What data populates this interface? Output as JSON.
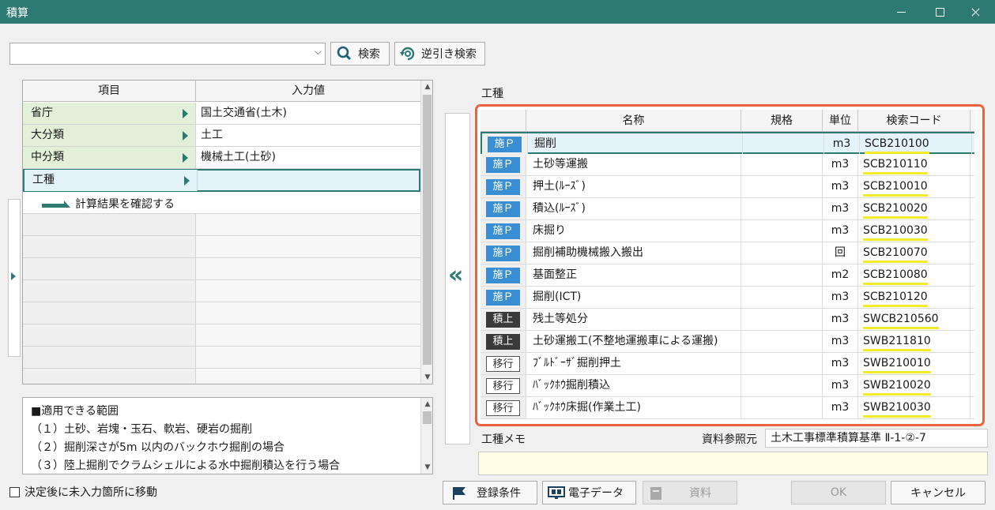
{
  "window": {
    "title": "積算"
  },
  "toolbar": {
    "combo_value": "",
    "search_label": "検索",
    "reverse_search_label": "逆引き検索"
  },
  "left_grid": {
    "headers": [
      "項目",
      "入力値"
    ],
    "rows": [
      {
        "key": "省庁",
        "value": "国土交通省(土木)"
      },
      {
        "key": "大分類",
        "value": "土工"
      },
      {
        "key": "中分類",
        "value": "機械土工(土砂)"
      },
      {
        "key": "工種",
        "value": ""
      }
    ],
    "calc_link": "計算結果を確認する"
  },
  "scope_memo": {
    "lines": [
      "■適用できる範囲",
      "（１）土砂、岩塊・玉石、軟岩、硬岩の掘削",
      "（２）掘削深さが5m 以内のバックホウ掘削の場合",
      "（３）陸上掘削でクラムシェルによる水中掘削積込を行う場合"
    ]
  },
  "options": {
    "move_to_unfilled": "決定後に未入力箇所に移動"
  },
  "right_panel": {
    "section_title": "工種",
    "headers": {
      "name": "名称",
      "spec": "規格",
      "unit": "単位",
      "code": "検索コード"
    },
    "rows": [
      {
        "tag": "施Ｐ",
        "tag_style": "blue",
        "name": "掘削",
        "spec": "",
        "unit": "m3",
        "code": "SCB210100"
      },
      {
        "tag": "施Ｐ",
        "tag_style": "blue",
        "name": "土砂等運搬",
        "spec": "",
        "unit": "m3",
        "code": "SCB210110"
      },
      {
        "tag": "施Ｐ",
        "tag_style": "blue",
        "name": "押土(ﾙｰｽﾞ)",
        "spec": "",
        "unit": "m3",
        "code": "SCB210010"
      },
      {
        "tag": "施Ｐ",
        "tag_style": "blue",
        "name": "積込(ﾙｰｽﾞ)",
        "spec": "",
        "unit": "m3",
        "code": "SCB210020"
      },
      {
        "tag": "施Ｐ",
        "tag_style": "blue",
        "name": "床掘り",
        "spec": "",
        "unit": "m3",
        "code": "SCB210030"
      },
      {
        "tag": "施Ｐ",
        "tag_style": "blue",
        "name": "掘削補助機械搬入搬出",
        "spec": "",
        "unit": "回",
        "code": "SCB210070"
      },
      {
        "tag": "施Ｐ",
        "tag_style": "blue",
        "name": "基面整正",
        "spec": "",
        "unit": "m2",
        "code": "SCB210080"
      },
      {
        "tag": "施Ｐ",
        "tag_style": "blue",
        "name": "掘削(ICT)",
        "spec": "",
        "unit": "m3",
        "code": "SCB210120"
      },
      {
        "tag": "積上",
        "tag_style": "dark",
        "name": "残土等処分",
        "spec": "",
        "unit": "m3",
        "code": "SWCB210560"
      },
      {
        "tag": "積上",
        "tag_style": "dark",
        "name": "土砂運搬工(不整地運搬車による運搬)",
        "spec": "",
        "unit": "m3",
        "code": "SWB211810"
      },
      {
        "tag": "移行",
        "tag_style": "outline",
        "name": "ﾌﾞﾙﾄﾞｰｻﾞ掘削押土",
        "spec": "",
        "unit": "m3",
        "code": "SWB210010"
      },
      {
        "tag": "移行",
        "tag_style": "outline",
        "name": "ﾊﾞｯｸﾎｳ掘削積込",
        "spec": "",
        "unit": "m3",
        "code": "SWB210020"
      },
      {
        "tag": "移行",
        "tag_style": "outline",
        "name": "ﾊﾞｯｸﾎｳ床掘(作業土工)",
        "spec": "",
        "unit": "m3",
        "code": "SWB210030"
      }
    ],
    "memo_label": "工種メモ",
    "ref_label": "資料参照元",
    "ref_value": "土木工事標準積算基準 Ⅱ-1-②-7",
    "memo_value": ""
  },
  "footer": {
    "register_conditions": "登録条件",
    "electronic_data": "電子データ",
    "materials": "資料",
    "ok": "OK",
    "cancel": "キャンセル"
  },
  "colors": {
    "accent": "#2d7a72",
    "highlight_border": "#e8643c",
    "code_underline": "#f3ea2a",
    "tag_blue": "#3a8ed4"
  }
}
